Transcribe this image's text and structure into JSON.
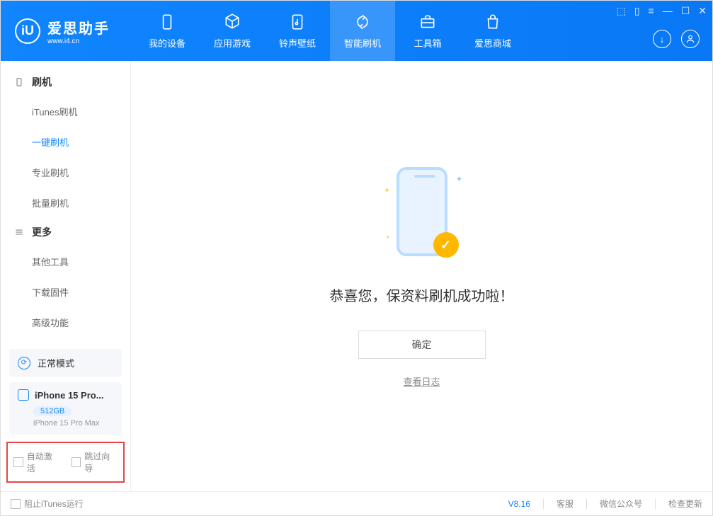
{
  "app": {
    "title": "爱思助手",
    "url": "www.i4.cn"
  },
  "nav": [
    {
      "label": "我的设备",
      "icon": "device"
    },
    {
      "label": "应用游戏",
      "icon": "cube"
    },
    {
      "label": "铃声壁纸",
      "icon": "music"
    },
    {
      "label": "智能刷机",
      "icon": "refresh",
      "active": true
    },
    {
      "label": "工具箱",
      "icon": "toolbox"
    },
    {
      "label": "爱思商城",
      "icon": "bag"
    }
  ],
  "sidebar": {
    "group1": {
      "title": "刷机",
      "items": [
        "iTunes刷机",
        "一键刷机",
        "专业刷机",
        "批量刷机"
      ],
      "active_index": 1
    },
    "group2": {
      "title": "更多",
      "items": [
        "其他工具",
        "下载固件",
        "高级功能"
      ]
    }
  },
  "status": {
    "label": "正常模式"
  },
  "device": {
    "name": "iPhone 15 Pro...",
    "storage": "512GB",
    "model": "iPhone 15 Pro Max"
  },
  "options": {
    "auto_activate": "自动激活",
    "skip_guide": "跳过向导"
  },
  "main": {
    "success_text": "恭喜您，保资料刷机成功啦！",
    "confirm": "确定",
    "view_log": "查看日志"
  },
  "footer": {
    "block_itunes": "阻止iTunes运行",
    "version": "V8.16",
    "support": "客服",
    "wechat": "微信公众号",
    "check_update": "检查更新"
  }
}
